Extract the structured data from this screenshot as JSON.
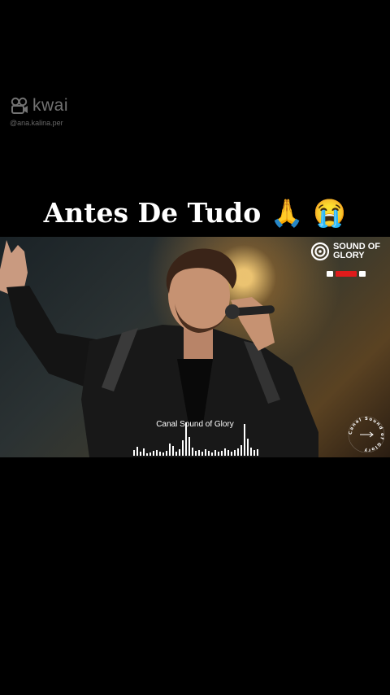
{
  "watermark": {
    "logo": "kwai",
    "handle": "@ana.kalina.per"
  },
  "title": "Antes De Tudo 🙏 😭",
  "video": {
    "brand_line1": "SOUND OF",
    "brand_line2": "GLORY",
    "caption": "Canal Sound of Glory",
    "badge_text": "Canal Sound of Glory"
  },
  "colors": {
    "background": "#000000",
    "subscribe": "#e01b1b",
    "warm_light": "#f0b25a"
  },
  "icons": [
    "kwai-logo-icon",
    "sound-of-glory-logo-icon",
    "subscribe-icon",
    "waveform-icon",
    "circular-badge-icon"
  ]
}
